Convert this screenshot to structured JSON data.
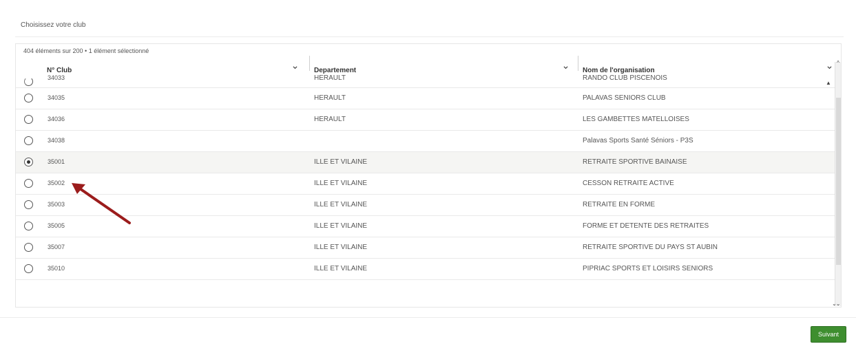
{
  "panel": {
    "title": "Choisissez votre club"
  },
  "grid": {
    "info": "404 éléments sur 200 • 1 élément sélectionné",
    "columns": [
      {
        "label": "N° Club"
      },
      {
        "label": "Departement"
      },
      {
        "label": "Nom de l'organisation"
      }
    ],
    "rows": [
      {
        "num": "34033",
        "dept": "HERAULT",
        "org": "RANDO CLUB PISCENOIS",
        "selected": false
      },
      {
        "num": "34035",
        "dept": "HERAULT",
        "org": "PALAVAS SENIORS CLUB",
        "selected": false
      },
      {
        "num": "34036",
        "dept": "HERAULT",
        "org": "LES GAMBETTES MATELLOISES",
        "selected": false
      },
      {
        "num": "34038",
        "dept": "",
        "org": "Palavas Sports Santé Séniors - P3S",
        "selected": false
      },
      {
        "num": "35001",
        "dept": "ILLE ET VILAINE",
        "org": "RETRAITE SPORTIVE BAINAISE",
        "selected": true
      },
      {
        "num": "35002",
        "dept": "ILLE ET VILAINE",
        "org": "CESSON RETRAITE ACTIVE",
        "selected": false
      },
      {
        "num": "35003",
        "dept": "ILLE ET VILAINE",
        "org": "RETRAITE EN FORME",
        "selected": false
      },
      {
        "num": "35005",
        "dept": "ILLE ET VILAINE",
        "org": "FORME ET DETENTE DES RETRAITES",
        "selected": false
      },
      {
        "num": "35007",
        "dept": "ILLE ET VILAINE",
        "org": "RETRAITE SPORTIVE DU PAYS ST AUBIN",
        "selected": false
      },
      {
        "num": "35010",
        "dept": "ILLE ET VILAINE",
        "org": "PIPRIAC SPORTS ET LOISIRS SENIORS",
        "selected": false
      }
    ]
  },
  "footer": {
    "next_label": "Suivant"
  },
  "colors": {
    "accent": "#3e8e2f",
    "annotation_arrow": "#9b1c1c"
  },
  "icons": {
    "sort": "chevron-down-icon",
    "scroll_up": "chevron-up-icon",
    "scroll_down": "chevron-down-icon"
  }
}
